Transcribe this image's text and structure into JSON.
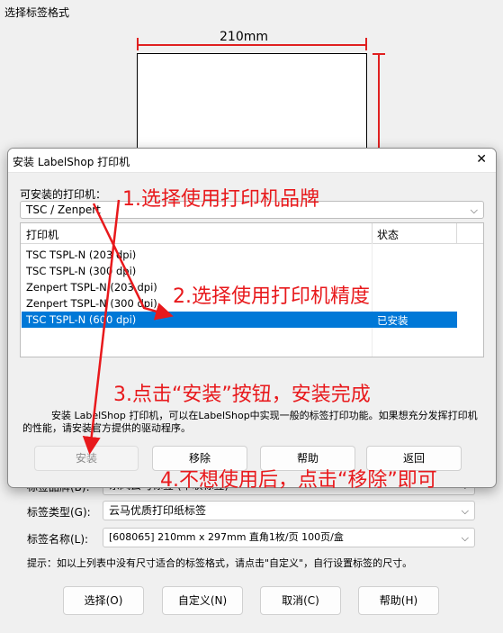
{
  "background_window": {
    "title": "选择标签格式",
    "width_label": "210mm",
    "fields": [
      {
        "label": "标签品牌(B):",
        "value": "东风云马标签 (中联标签)"
      },
      {
        "label": "标签类型(G):",
        "value": "云马优质打印纸标签"
      },
      {
        "label": "标签名称(L):",
        "value": "[608065] 210mm x 297mm 直角1枚/页 100页/盒"
      }
    ],
    "hint": "提示：如以上列表中没有尺寸适合的标签格式，请点击\"自定义\"，自行设置标签的尺寸。",
    "buttons": {
      "select": "选择(O)",
      "custom": "自定义(N)",
      "cancel": "取消(C)",
      "help": "帮助(H)"
    }
  },
  "install_dialog": {
    "title": "安装 LabelShop 打印机",
    "close_glyph": "✕",
    "installable_label": "可安装的打印机：",
    "brand_select_value": "TSC / Zenpert",
    "table": {
      "columns": [
        "打印机",
        "状态"
      ],
      "rows": [
        {
          "printer": "TSC TSPL-N (203 dpi)",
          "status": ""
        },
        {
          "printer": "TSC TSPL-N (300 dpi)",
          "status": ""
        },
        {
          "printer": "Zenpert TSPL-N (203 dpi)",
          "status": ""
        },
        {
          "printer": "Zenpert TSPL-N (300 dpi)",
          "status": ""
        },
        {
          "printer": "TSC TSPL-N (600 dpi)",
          "status": "已安装",
          "selected": true
        }
      ]
    },
    "description": "安装 LabelShop 打印机，可以在LabelShop中实现一般的标签打印功能。如果想充分发挥打印机的性能，请安装官方提供的驱动程序。",
    "buttons": {
      "install": "安装",
      "remove": "移除",
      "help": "帮助",
      "back": "返回"
    }
  },
  "annotations": {
    "step1": "1.选择使用打印机品牌",
    "step2": "2.选择使用打印机精度",
    "step3": "3.点击“安装”按钮，安装完成",
    "step4": "4.不想使用后，点击“移除”即可"
  },
  "colors": {
    "annotation_red": "#e8191c",
    "selection_blue": "#0078d7"
  }
}
